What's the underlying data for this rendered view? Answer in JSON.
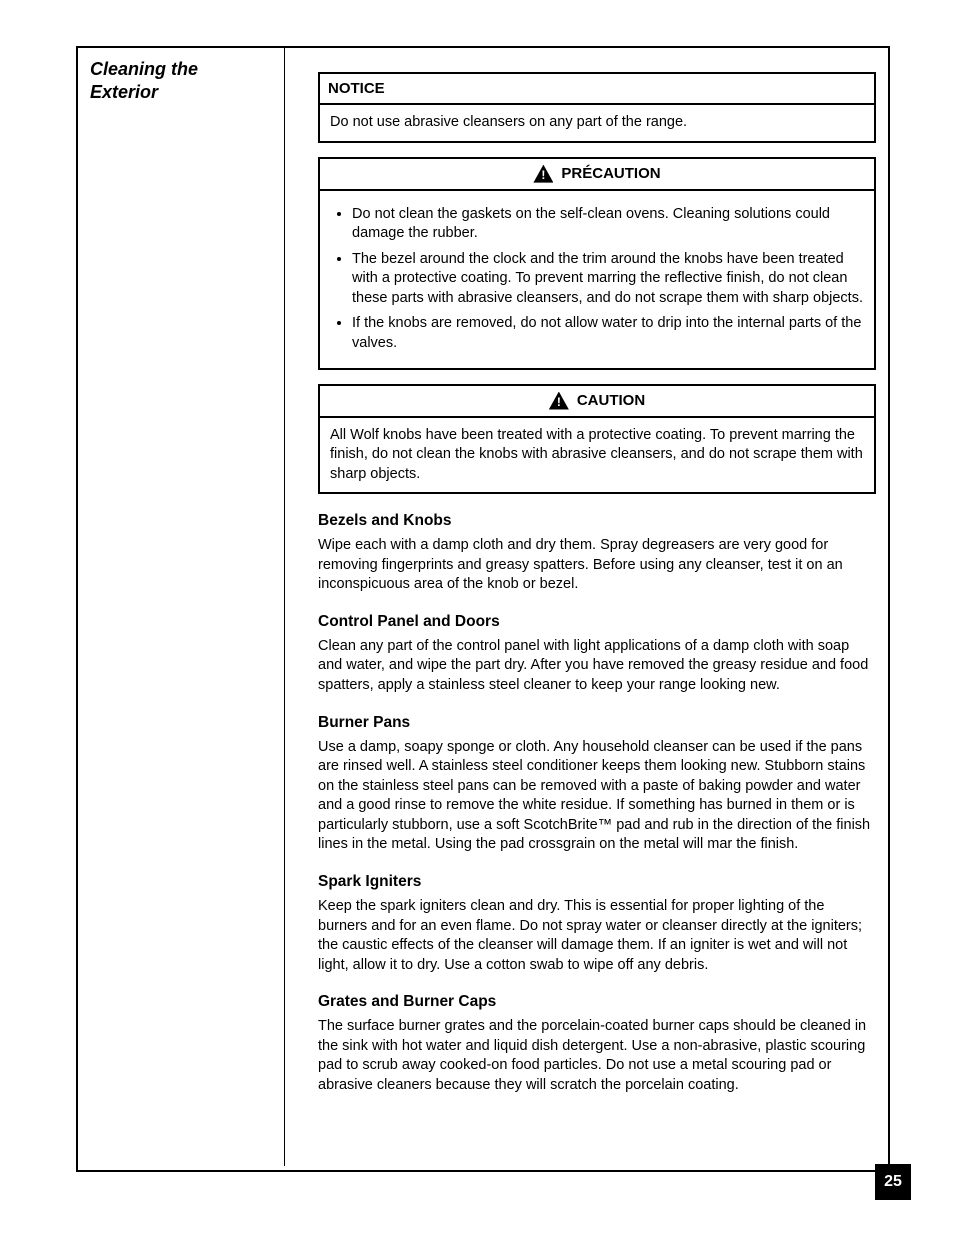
{
  "sidebar": {
    "title_line1": "Cleaning the",
    "title_line2": "Exterior"
  },
  "notice_box": {
    "head": "NOTICE",
    "body": "Do not use abrasive cleansers on any part of the range."
  },
  "precaution_box": {
    "head": "PRÉCAUTION",
    "bullets": [
      "Do not clean the gaskets on the self-clean ovens. Cleaning solutions could damage the rubber.",
      "The bezel around the clock and the trim around the knobs have been treated with a protective coating. To prevent marring the reflective finish, do not clean these parts with abrasive cleansers, and do not scrape them with sharp objects.",
      "If the knobs are removed, do not allow water to drip into the internal parts of the valves."
    ]
  },
  "caution_box": {
    "head": "CAUTION",
    "body": "All Wolf knobs have been treated with a protective coating. To prevent marring the finish, do not clean the knobs with abrasive cleansers, and do not scrape them with sharp objects."
  },
  "sections": [
    {
      "head": "Bezels and Knobs",
      "para": "Wipe each with a damp cloth and dry them. Spray degreasers are very good for removing fingerprints and greasy spatters. Before using any cleanser, test it on an inconspicuous area of the knob or bezel."
    },
    {
      "head": "Control Panel and Doors",
      "para": "Clean any part of the control panel with light applications of a damp cloth with soap and water, and wipe the part dry. After you have removed the greasy residue and food spatters, apply a stainless steel cleaner to keep your range looking new."
    },
    {
      "head": "Burner Pans",
      "para": "Use a damp, soapy sponge or cloth. Any household cleanser can be used if the pans are rinsed well. A stainless steel conditioner keeps them looking new. Stubborn stains on the stainless steel pans can be removed with a paste of baking powder and water and a good rinse to remove the white residue. If something has burned in them or is particularly stubborn, use a soft ScotchBrite™ pad and rub in the direction of the finish lines in the metal. Using the pad crossgrain on the metal will mar the finish."
    },
    {
      "head": "Spark Igniters",
      "para": "Keep the spark igniters clean and dry. This is essential for proper lighting of the burners and for an even flame. Do not spray water or cleanser directly at the igniters; the caustic effects of the cleanser will damage them. If an igniter is wet and will not light, allow it to dry. Use a cotton swab to wipe off any debris."
    },
    {
      "head": "Grates and Burner Caps",
      "para": "The surface burner grates and the porcelain-coated burner caps should be cleaned in the sink with hot water and liquid dish detergent. Use a non-abrasive, plastic scouring pad to scrub away cooked-on food particles. Do not use a metal scouring pad or abrasive cleaners because they will scratch the porcelain coating."
    }
  ],
  "page_number": "25"
}
